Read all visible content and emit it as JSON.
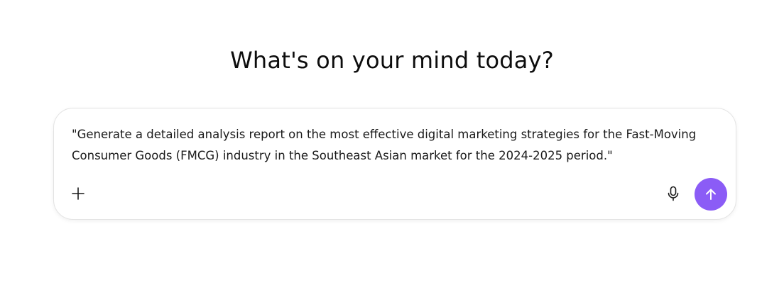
{
  "heading": "What's on your mind today?",
  "composer": {
    "prompt_text": "\"Generate a detailed analysis report on the most effective digital marketing strategies for the Fast-Moving Consumer Goods (FMCG) industry in the Southeast Asian market for the 2024-2025 period.\"",
    "icons": {
      "add": "plus-icon",
      "voice": "microphone-icon",
      "send": "arrow-up-icon"
    }
  },
  "colors": {
    "send_button": "#8b5cf6",
    "border": "#e3e3e3",
    "text": "#1a1a1a"
  }
}
